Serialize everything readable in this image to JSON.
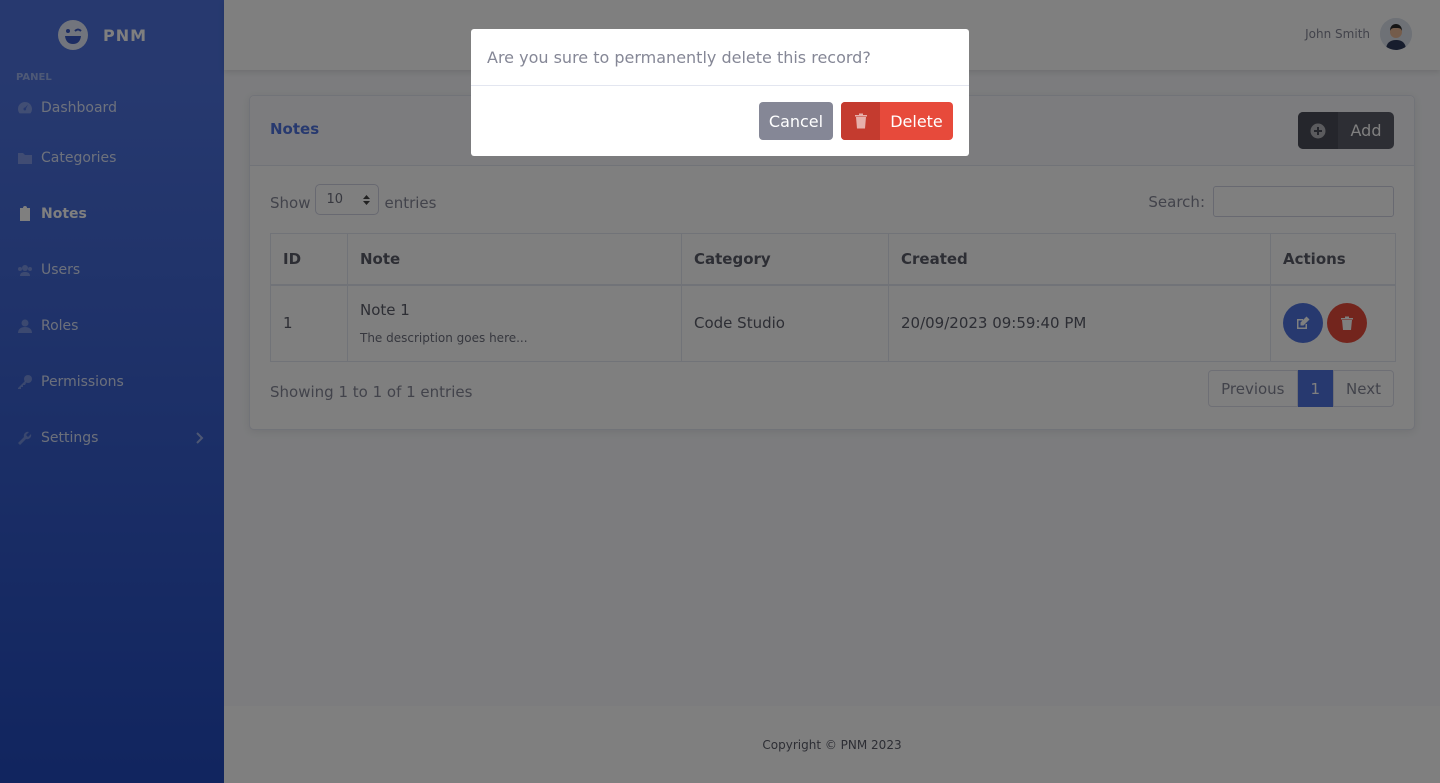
{
  "app": {
    "brand": "PNM"
  },
  "sidebar": {
    "heading": "PANEL",
    "items": [
      {
        "label": "Dashboard",
        "icon": "tachometer-icon"
      },
      {
        "label": "Categories",
        "icon": "folder-icon"
      },
      {
        "label": "Notes",
        "icon": "clipboard-icon",
        "active": true
      },
      {
        "label": "Users",
        "icon": "users-icon"
      },
      {
        "label": "Roles",
        "icon": "user-icon"
      },
      {
        "label": "Permissions",
        "icon": "key-icon"
      },
      {
        "label": "Settings",
        "icon": "wrench-icon"
      }
    ]
  },
  "topbar": {
    "user_name": "John Smith"
  },
  "card": {
    "title": "Notes",
    "add_label": "Add",
    "show_label": "Show",
    "entries_label": "entries",
    "page_size": "10",
    "search_label": "Search:",
    "table": {
      "headers": [
        "ID",
        "Note",
        "Category",
        "Created",
        "Actions"
      ],
      "rows": [
        {
          "id": "1",
          "note_title": "Note 1",
          "note_desc": "The description goes here...",
          "category": "Code Studio",
          "created": "20/09/2023 09:59:40 PM"
        }
      ]
    },
    "info": "Showing 1 to 1 of 1 entries",
    "pager": {
      "previous": "Previous",
      "current": "1",
      "next": "Next"
    }
  },
  "footer": {
    "text": "Copyright © PNM 2023"
  },
  "modal": {
    "message": "Are you sure to permanently delete this record?",
    "cancel_label": "Cancel",
    "delete_label": "Delete"
  },
  "colors": {
    "primary": "#4e73df",
    "danger": "#e74a3b",
    "secondary": "#858796",
    "dark": "#5a5c69"
  }
}
